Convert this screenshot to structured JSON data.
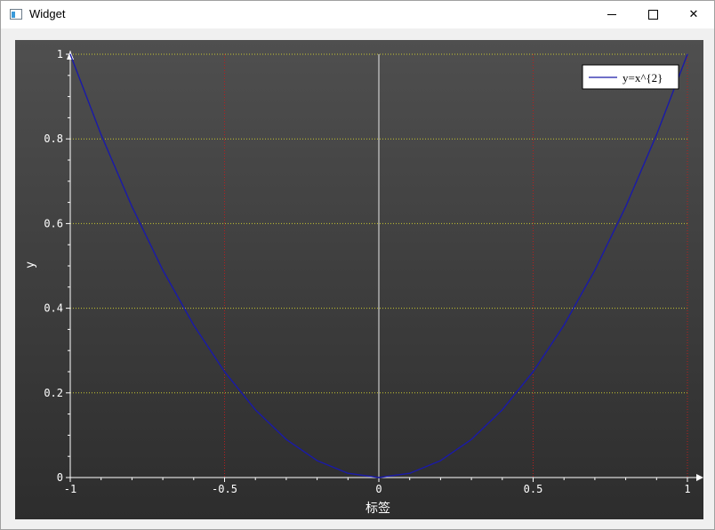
{
  "window": {
    "title": "Widget",
    "controls": {
      "minimize": "minimize",
      "maximize": "maximize",
      "close": "close"
    }
  },
  "colors": {
    "bg_top": "#4f4f4f",
    "bg_bottom": "#2d2d2d",
    "curve": "#1a1aa8",
    "h_grid": "#c8c830",
    "v_grid": "#b81e1e",
    "zero_line": "#e8e8e8",
    "axis": "#ffffff"
  },
  "chart_data": {
    "type": "line",
    "function": "y = x^2",
    "xlabel": "标签",
    "ylabel": "y",
    "xlim": [
      -1,
      1
    ],
    "ylim": [
      0,
      1
    ],
    "xticks": [
      -1,
      -0.5,
      0,
      0.5,
      1
    ],
    "xtick_labels": [
      "-1",
      "-0.5",
      "0",
      "0.5",
      "1"
    ],
    "yticks": [
      0,
      0.2,
      0.4,
      0.6,
      0.8,
      1
    ],
    "ytick_labels": [
      "0",
      "0.2",
      "0.4",
      "0.6",
      "0.8",
      "1"
    ],
    "grid": true,
    "legend_position": "top-right",
    "series": [
      {
        "name": "y=x^{2}",
        "x": [
          -1,
          -0.9,
          -0.8,
          -0.7,
          -0.6,
          -0.5,
          -0.4,
          -0.3,
          -0.2,
          -0.1,
          0,
          0.1,
          0.2,
          0.3,
          0.4,
          0.5,
          0.6,
          0.7,
          0.8,
          0.9,
          1
        ],
        "y": [
          1,
          0.81,
          0.64,
          0.49,
          0.36,
          0.25,
          0.16,
          0.09,
          0.04,
          0.01,
          0,
          0.01,
          0.04,
          0.09,
          0.16,
          0.25,
          0.36,
          0.49,
          0.64,
          0.81,
          1
        ]
      }
    ]
  }
}
